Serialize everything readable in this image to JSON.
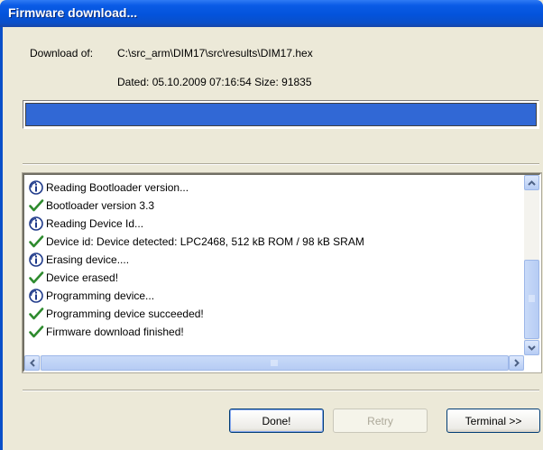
{
  "window": {
    "title": "Firmware download..."
  },
  "download": {
    "label": "Download of:",
    "path": "C:\\src_arm\\DIM17\\src\\results\\DIM17.hex",
    "dated": "Dated: 05.10.2009 07:16:54 Size: 91835"
  },
  "progress": {
    "fraction": 1.0
  },
  "log": {
    "items": [
      {
        "icon": "info-icon",
        "text": "Reading Bootloader version..."
      },
      {
        "icon": "checkmark-icon",
        "text": "Bootloader version 3.3"
      },
      {
        "icon": "info-icon",
        "text": "Reading Device Id..."
      },
      {
        "icon": "checkmark-icon",
        "text": "Device id: Device detected: LPC2468, 512 kB ROM / 98 kB SRAM"
      },
      {
        "icon": "info-icon",
        "text": "Erasing device...."
      },
      {
        "icon": "checkmark-icon",
        "text": "Device erased!"
      },
      {
        "icon": "info-icon",
        "text": "Programming device..."
      },
      {
        "icon": "checkmark-icon",
        "text": "Programming device succeeded!"
      },
      {
        "icon": "checkmark-icon",
        "text": "Firmware download finished!"
      }
    ]
  },
  "buttons": {
    "done": "Done!",
    "retry": "Retry",
    "terminal": "Terminal >>"
  },
  "colors": {
    "title_bar": "#0353DB",
    "progress_fill": "#3168D5",
    "check_green": "#2E8B2E"
  }
}
